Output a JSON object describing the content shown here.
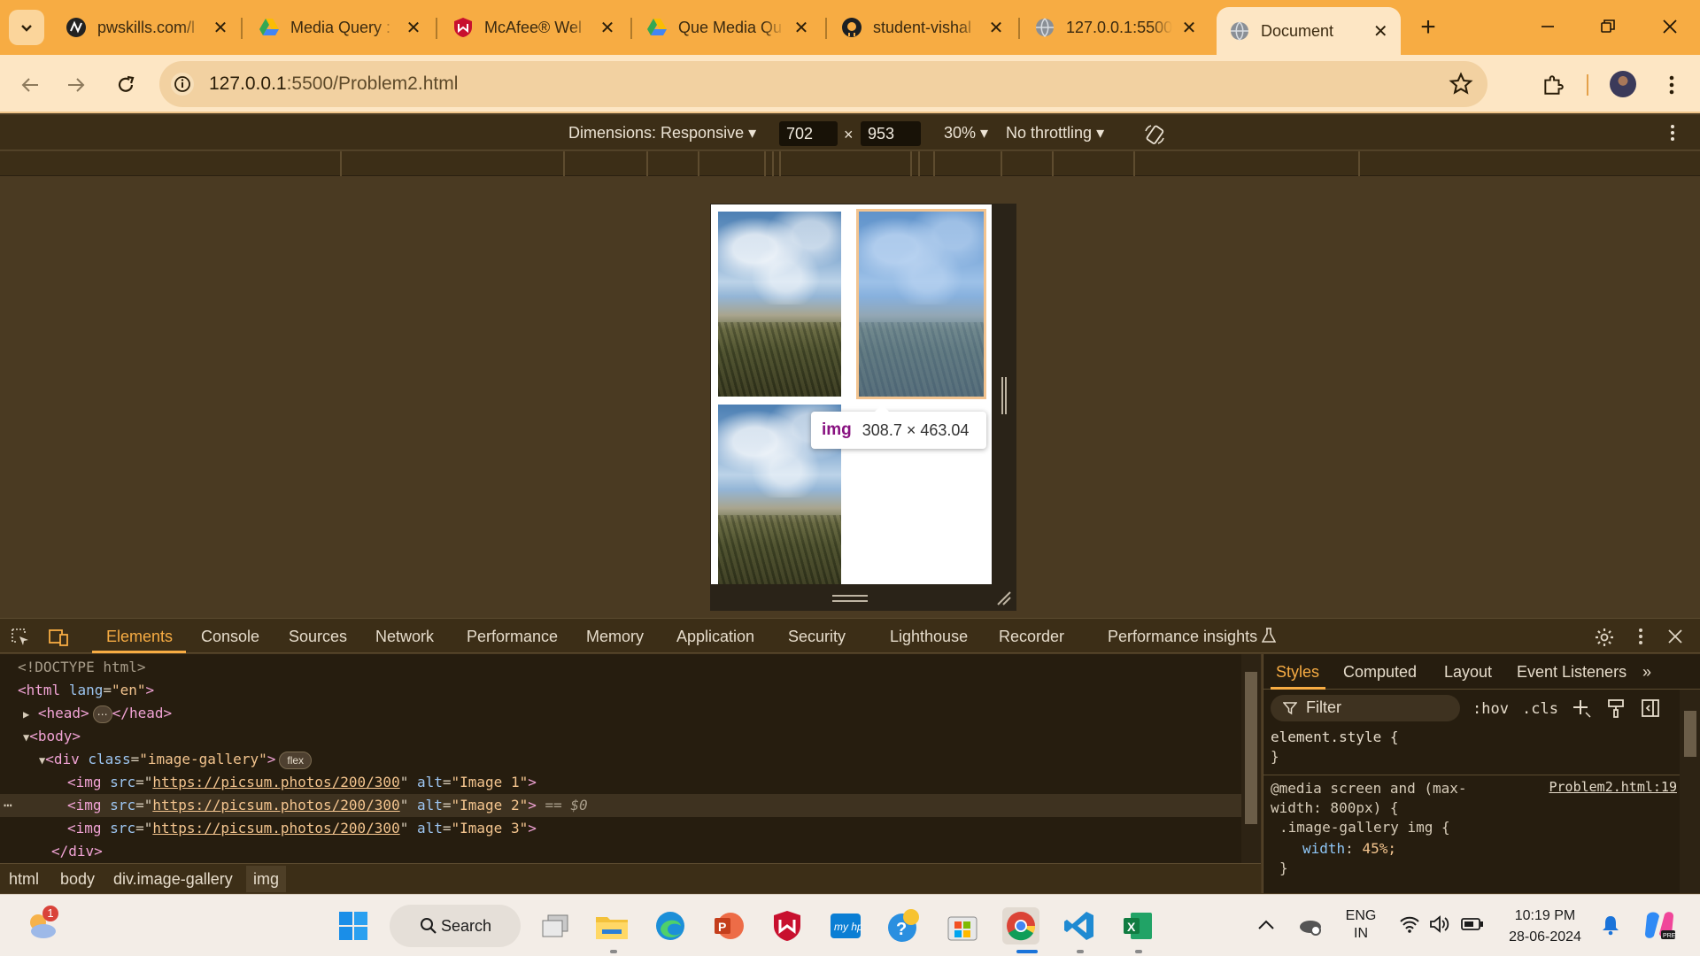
{
  "browser": {
    "tabs": [
      {
        "title": "pwskills.com/l",
        "icon": "pwskills-favicon"
      },
      {
        "title": "Media Query :",
        "icon": "google-drive-favicon"
      },
      {
        "title": "McAfee® Wel",
        "icon": "mcafee-favicon"
      },
      {
        "title": "Que Media Qu",
        "icon": "google-drive-favicon"
      },
      {
        "title": "student-vishal",
        "icon": "github-favicon"
      },
      {
        "title": "127.0.0.1:5500",
        "icon": "globe-favicon"
      },
      {
        "title": "Document",
        "icon": "globe-favicon",
        "active": true
      }
    ],
    "address": {
      "host": "127.0.0.1",
      "path": ":5500/Problem2.html"
    }
  },
  "device_toolbar": {
    "dimensions_label": "Dimensions: Responsive",
    "width": "702",
    "height": "953",
    "times": "×",
    "zoom": "30%",
    "throttling": "No throttling"
  },
  "viewport": {
    "tooltip_tag": "img",
    "tooltip_dims": "308.7 × 463.04"
  },
  "devtools": {
    "tabs": [
      "Elements",
      "Console",
      "Sources",
      "Network",
      "Performance",
      "Memory",
      "Application",
      "Security",
      "Lighthouse",
      "Recorder",
      "Performance insights"
    ],
    "dom": {
      "doctype": "<!DOCTYPE html>",
      "html_open": "<html",
      "lang_attr": "lang",
      "lang_val": "\"en\"",
      "gt": ">",
      "head": "<head>",
      "head_close": "</head>",
      "ellipsis": "⋯",
      "body": "<body>",
      "div_open": "<div",
      "class_attr": "class",
      "class_val": "\"image-gallery\"",
      "flex_badge": "flex",
      "img_open": "<img",
      "src_attr": "src",
      "src_val": "https://picsum.photos/200/300",
      "alt_attr": "alt",
      "alt_vals": [
        "\"Image 1\"",
        "\"Image 2\"",
        "\"Image 3\""
      ],
      "selected_marker": "== $0",
      "div_close": "</div>",
      "gutter_dots": "⋯"
    },
    "breadcrumbs": [
      "html",
      "body",
      "div.image-gallery",
      "img"
    ],
    "styles": {
      "tabs": [
        "Styles",
        "Computed",
        "Layout",
        "Event Listeners"
      ],
      "filter_placeholder": "Filter",
      "hov": ":hov",
      "cls": ".cls",
      "element_style": "element.style {",
      "brace_close": "}",
      "media_line1": "@media screen and (max-",
      "media_line2": "width: 800px) {",
      "rule_selector": ".image-gallery img {",
      "rule_prop": "width",
      "rule_val": "45%;",
      "source_link": "Problem2.html:19"
    }
  },
  "taskbar": {
    "search_label": "Search",
    "lang_line1": "ENG",
    "lang_line2": "IN",
    "time": "10:19 PM",
    "date": "28-06-2024",
    "weather_badge": "1"
  },
  "colors": {
    "accent": "#f7ac43",
    "tab_active": "#fde6c4",
    "devtools_bg": "#261d0f"
  }
}
